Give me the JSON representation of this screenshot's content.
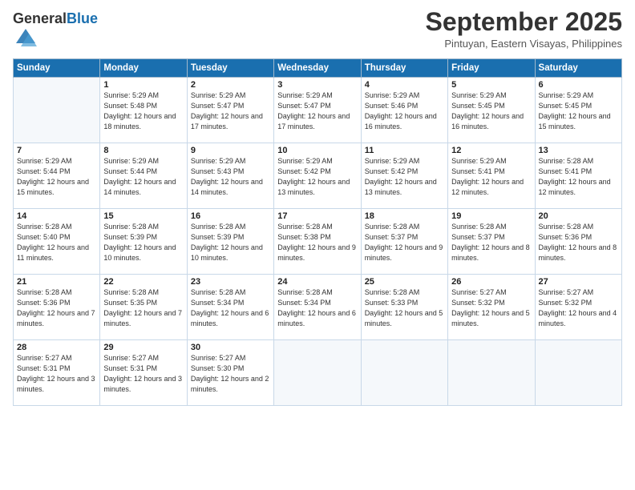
{
  "header": {
    "logo_general": "General",
    "logo_blue": "Blue",
    "month_title": "September 2025",
    "subtitle": "Pintuyan, Eastern Visayas, Philippines"
  },
  "days_of_week": [
    "Sunday",
    "Monday",
    "Tuesday",
    "Wednesday",
    "Thursday",
    "Friday",
    "Saturday"
  ],
  "weeks": [
    [
      {
        "day": "",
        "sunrise": "",
        "sunset": "",
        "daylight": ""
      },
      {
        "day": "1",
        "sunrise": "Sunrise: 5:29 AM",
        "sunset": "Sunset: 5:48 PM",
        "daylight": "Daylight: 12 hours and 18 minutes."
      },
      {
        "day": "2",
        "sunrise": "Sunrise: 5:29 AM",
        "sunset": "Sunset: 5:47 PM",
        "daylight": "Daylight: 12 hours and 17 minutes."
      },
      {
        "day": "3",
        "sunrise": "Sunrise: 5:29 AM",
        "sunset": "Sunset: 5:47 PM",
        "daylight": "Daylight: 12 hours and 17 minutes."
      },
      {
        "day": "4",
        "sunrise": "Sunrise: 5:29 AM",
        "sunset": "Sunset: 5:46 PM",
        "daylight": "Daylight: 12 hours and 16 minutes."
      },
      {
        "day": "5",
        "sunrise": "Sunrise: 5:29 AM",
        "sunset": "Sunset: 5:45 PM",
        "daylight": "Daylight: 12 hours and 16 minutes."
      },
      {
        "day": "6",
        "sunrise": "Sunrise: 5:29 AM",
        "sunset": "Sunset: 5:45 PM",
        "daylight": "Daylight: 12 hours and 15 minutes."
      }
    ],
    [
      {
        "day": "7",
        "sunrise": "Sunrise: 5:29 AM",
        "sunset": "Sunset: 5:44 PM",
        "daylight": "Daylight: 12 hours and 15 minutes."
      },
      {
        "day": "8",
        "sunrise": "Sunrise: 5:29 AM",
        "sunset": "Sunset: 5:44 PM",
        "daylight": "Daylight: 12 hours and 14 minutes."
      },
      {
        "day": "9",
        "sunrise": "Sunrise: 5:29 AM",
        "sunset": "Sunset: 5:43 PM",
        "daylight": "Daylight: 12 hours and 14 minutes."
      },
      {
        "day": "10",
        "sunrise": "Sunrise: 5:29 AM",
        "sunset": "Sunset: 5:42 PM",
        "daylight": "Daylight: 12 hours and 13 minutes."
      },
      {
        "day": "11",
        "sunrise": "Sunrise: 5:29 AM",
        "sunset": "Sunset: 5:42 PM",
        "daylight": "Daylight: 12 hours and 13 minutes."
      },
      {
        "day": "12",
        "sunrise": "Sunrise: 5:29 AM",
        "sunset": "Sunset: 5:41 PM",
        "daylight": "Daylight: 12 hours and 12 minutes."
      },
      {
        "day": "13",
        "sunrise": "Sunrise: 5:28 AM",
        "sunset": "Sunset: 5:41 PM",
        "daylight": "Daylight: 12 hours and 12 minutes."
      }
    ],
    [
      {
        "day": "14",
        "sunrise": "Sunrise: 5:28 AM",
        "sunset": "Sunset: 5:40 PM",
        "daylight": "Daylight: 12 hours and 11 minutes."
      },
      {
        "day": "15",
        "sunrise": "Sunrise: 5:28 AM",
        "sunset": "Sunset: 5:39 PM",
        "daylight": "Daylight: 12 hours and 10 minutes."
      },
      {
        "day": "16",
        "sunrise": "Sunrise: 5:28 AM",
        "sunset": "Sunset: 5:39 PM",
        "daylight": "Daylight: 12 hours and 10 minutes."
      },
      {
        "day": "17",
        "sunrise": "Sunrise: 5:28 AM",
        "sunset": "Sunset: 5:38 PM",
        "daylight": "Daylight: 12 hours and 9 minutes."
      },
      {
        "day": "18",
        "sunrise": "Sunrise: 5:28 AM",
        "sunset": "Sunset: 5:37 PM",
        "daylight": "Daylight: 12 hours and 9 minutes."
      },
      {
        "day": "19",
        "sunrise": "Sunrise: 5:28 AM",
        "sunset": "Sunset: 5:37 PM",
        "daylight": "Daylight: 12 hours and 8 minutes."
      },
      {
        "day": "20",
        "sunrise": "Sunrise: 5:28 AM",
        "sunset": "Sunset: 5:36 PM",
        "daylight": "Daylight: 12 hours and 8 minutes."
      }
    ],
    [
      {
        "day": "21",
        "sunrise": "Sunrise: 5:28 AM",
        "sunset": "Sunset: 5:36 PM",
        "daylight": "Daylight: 12 hours and 7 minutes."
      },
      {
        "day": "22",
        "sunrise": "Sunrise: 5:28 AM",
        "sunset": "Sunset: 5:35 PM",
        "daylight": "Daylight: 12 hours and 7 minutes."
      },
      {
        "day": "23",
        "sunrise": "Sunrise: 5:28 AM",
        "sunset": "Sunset: 5:34 PM",
        "daylight": "Daylight: 12 hours and 6 minutes."
      },
      {
        "day": "24",
        "sunrise": "Sunrise: 5:28 AM",
        "sunset": "Sunset: 5:34 PM",
        "daylight": "Daylight: 12 hours and 6 minutes."
      },
      {
        "day": "25",
        "sunrise": "Sunrise: 5:28 AM",
        "sunset": "Sunset: 5:33 PM",
        "daylight": "Daylight: 12 hours and 5 minutes."
      },
      {
        "day": "26",
        "sunrise": "Sunrise: 5:27 AM",
        "sunset": "Sunset: 5:32 PM",
        "daylight": "Daylight: 12 hours and 5 minutes."
      },
      {
        "day": "27",
        "sunrise": "Sunrise: 5:27 AM",
        "sunset": "Sunset: 5:32 PM",
        "daylight": "Daylight: 12 hours and 4 minutes."
      }
    ],
    [
      {
        "day": "28",
        "sunrise": "Sunrise: 5:27 AM",
        "sunset": "Sunset: 5:31 PM",
        "daylight": "Daylight: 12 hours and 3 minutes."
      },
      {
        "day": "29",
        "sunrise": "Sunrise: 5:27 AM",
        "sunset": "Sunset: 5:31 PM",
        "daylight": "Daylight: 12 hours and 3 minutes."
      },
      {
        "day": "30",
        "sunrise": "Sunrise: 5:27 AM",
        "sunset": "Sunset: 5:30 PM",
        "daylight": "Daylight: 12 hours and 2 minutes."
      },
      {
        "day": "",
        "sunrise": "",
        "sunset": "",
        "daylight": ""
      },
      {
        "day": "",
        "sunrise": "",
        "sunset": "",
        "daylight": ""
      },
      {
        "day": "",
        "sunrise": "",
        "sunset": "",
        "daylight": ""
      },
      {
        "day": "",
        "sunrise": "",
        "sunset": "",
        "daylight": ""
      }
    ]
  ]
}
